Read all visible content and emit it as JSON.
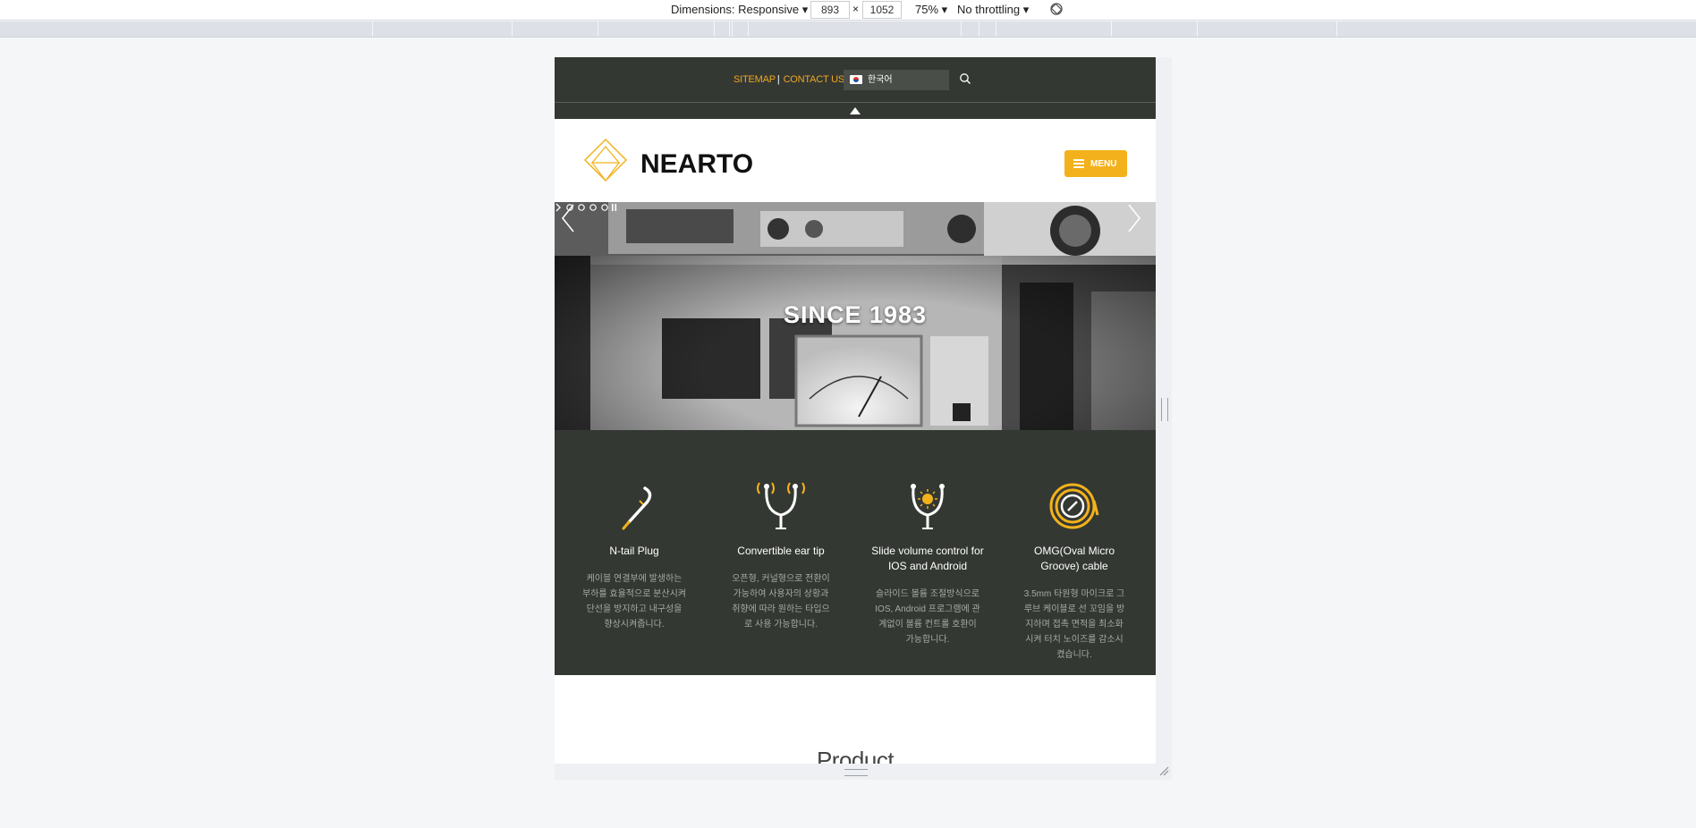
{
  "devtools": {
    "dimensions_label": "Dimensions: Responsive",
    "width": "893",
    "times": "×",
    "height": "1052",
    "zoom": "75%",
    "throttling": "No throttling"
  },
  "topbar": {
    "sitemap": "SITEMAP",
    "separator": "|",
    "contact": "CONTACT US",
    "language": "한국어"
  },
  "header": {
    "logo_text": "NEARTO",
    "menu_label": "MENU",
    "accent_color": "#f3b21b"
  },
  "hero": {
    "title": "SINCE 1983",
    "slide_count": 4
  },
  "features": [
    {
      "icon": "n-tail-plug-icon",
      "title": "N-tail Plug",
      "desc": "케이블 연결부에 발생하는 부하를 효율적으로 분산시켜 단선을 방지하고 내구성을 향상시켜줍니다."
    },
    {
      "icon": "ear-tip-icon",
      "title": "Convertible ear tip",
      "desc": "오픈형, 커널형으로 전환이 가능하여 사용자의 상황과 취향에 따라 원하는 타입으로 사용 가능합니다."
    },
    {
      "icon": "volume-control-icon",
      "title": "Slide volume control for IOS and Android",
      "desc": "슬라이드 볼륨 조절방식으로 IOS, Android 프로그램에 관계없이 볼륨 컨트롤 호환이 가능합니다."
    },
    {
      "icon": "omg-cable-icon",
      "title": "OMG(Oval Micro Groove) cable",
      "desc": "3.5mm 타원형 마이크로 그루브 케이블로 선 꼬임을 방지하며 접촉 면적을 최소화시켜 터치 노이즈를 감소시켰습니다."
    }
  ],
  "product": {
    "title": "Product"
  }
}
